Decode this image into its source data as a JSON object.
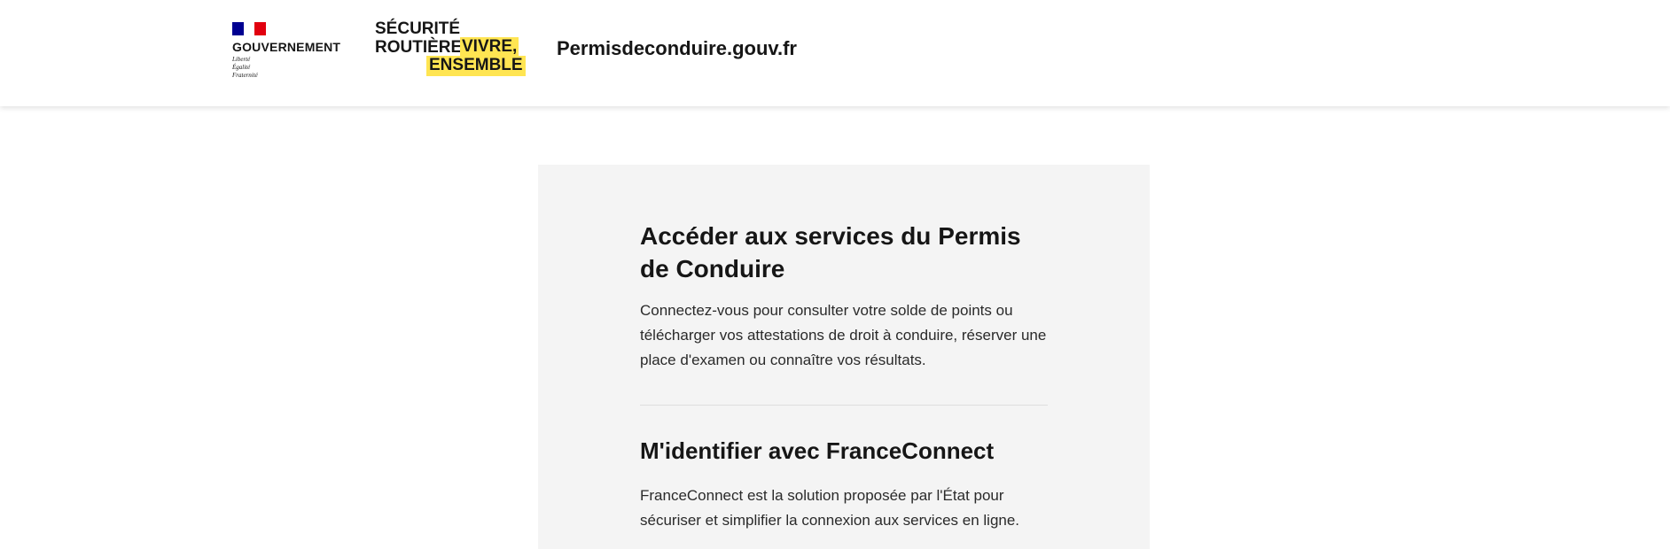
{
  "header": {
    "government": {
      "name": "GOUVERNEMENT",
      "motto": [
        "Liberté",
        "Égalité",
        "Fraternité"
      ],
      "flag_colors": [
        "#000091",
        "#ffffff",
        "#e1000f"
      ]
    },
    "securite_routiere": {
      "line1": "SÉCURITÉ",
      "line2": "ROUTIÈRE",
      "highlight1": "VIVRE,",
      "highlight2": "ENSEMBLE",
      "highlight_color": "#ffe552"
    },
    "site_title": "Permisdeconduire.gouv.fr"
  },
  "main": {
    "title": "Accéder aux services du Permis de Conduire",
    "intro": "Connectez-vous pour consulter votre solde de points ou télécharger vos attestations de droit à conduire, réserver une place d'examen ou connaître vos résultats.",
    "franceconnect": {
      "heading": "M'identifier avec FranceConnect",
      "description": "FranceConnect est la solution proposée par l'État pour sécuriser et simplifier la connexion aux services en ligne."
    }
  }
}
